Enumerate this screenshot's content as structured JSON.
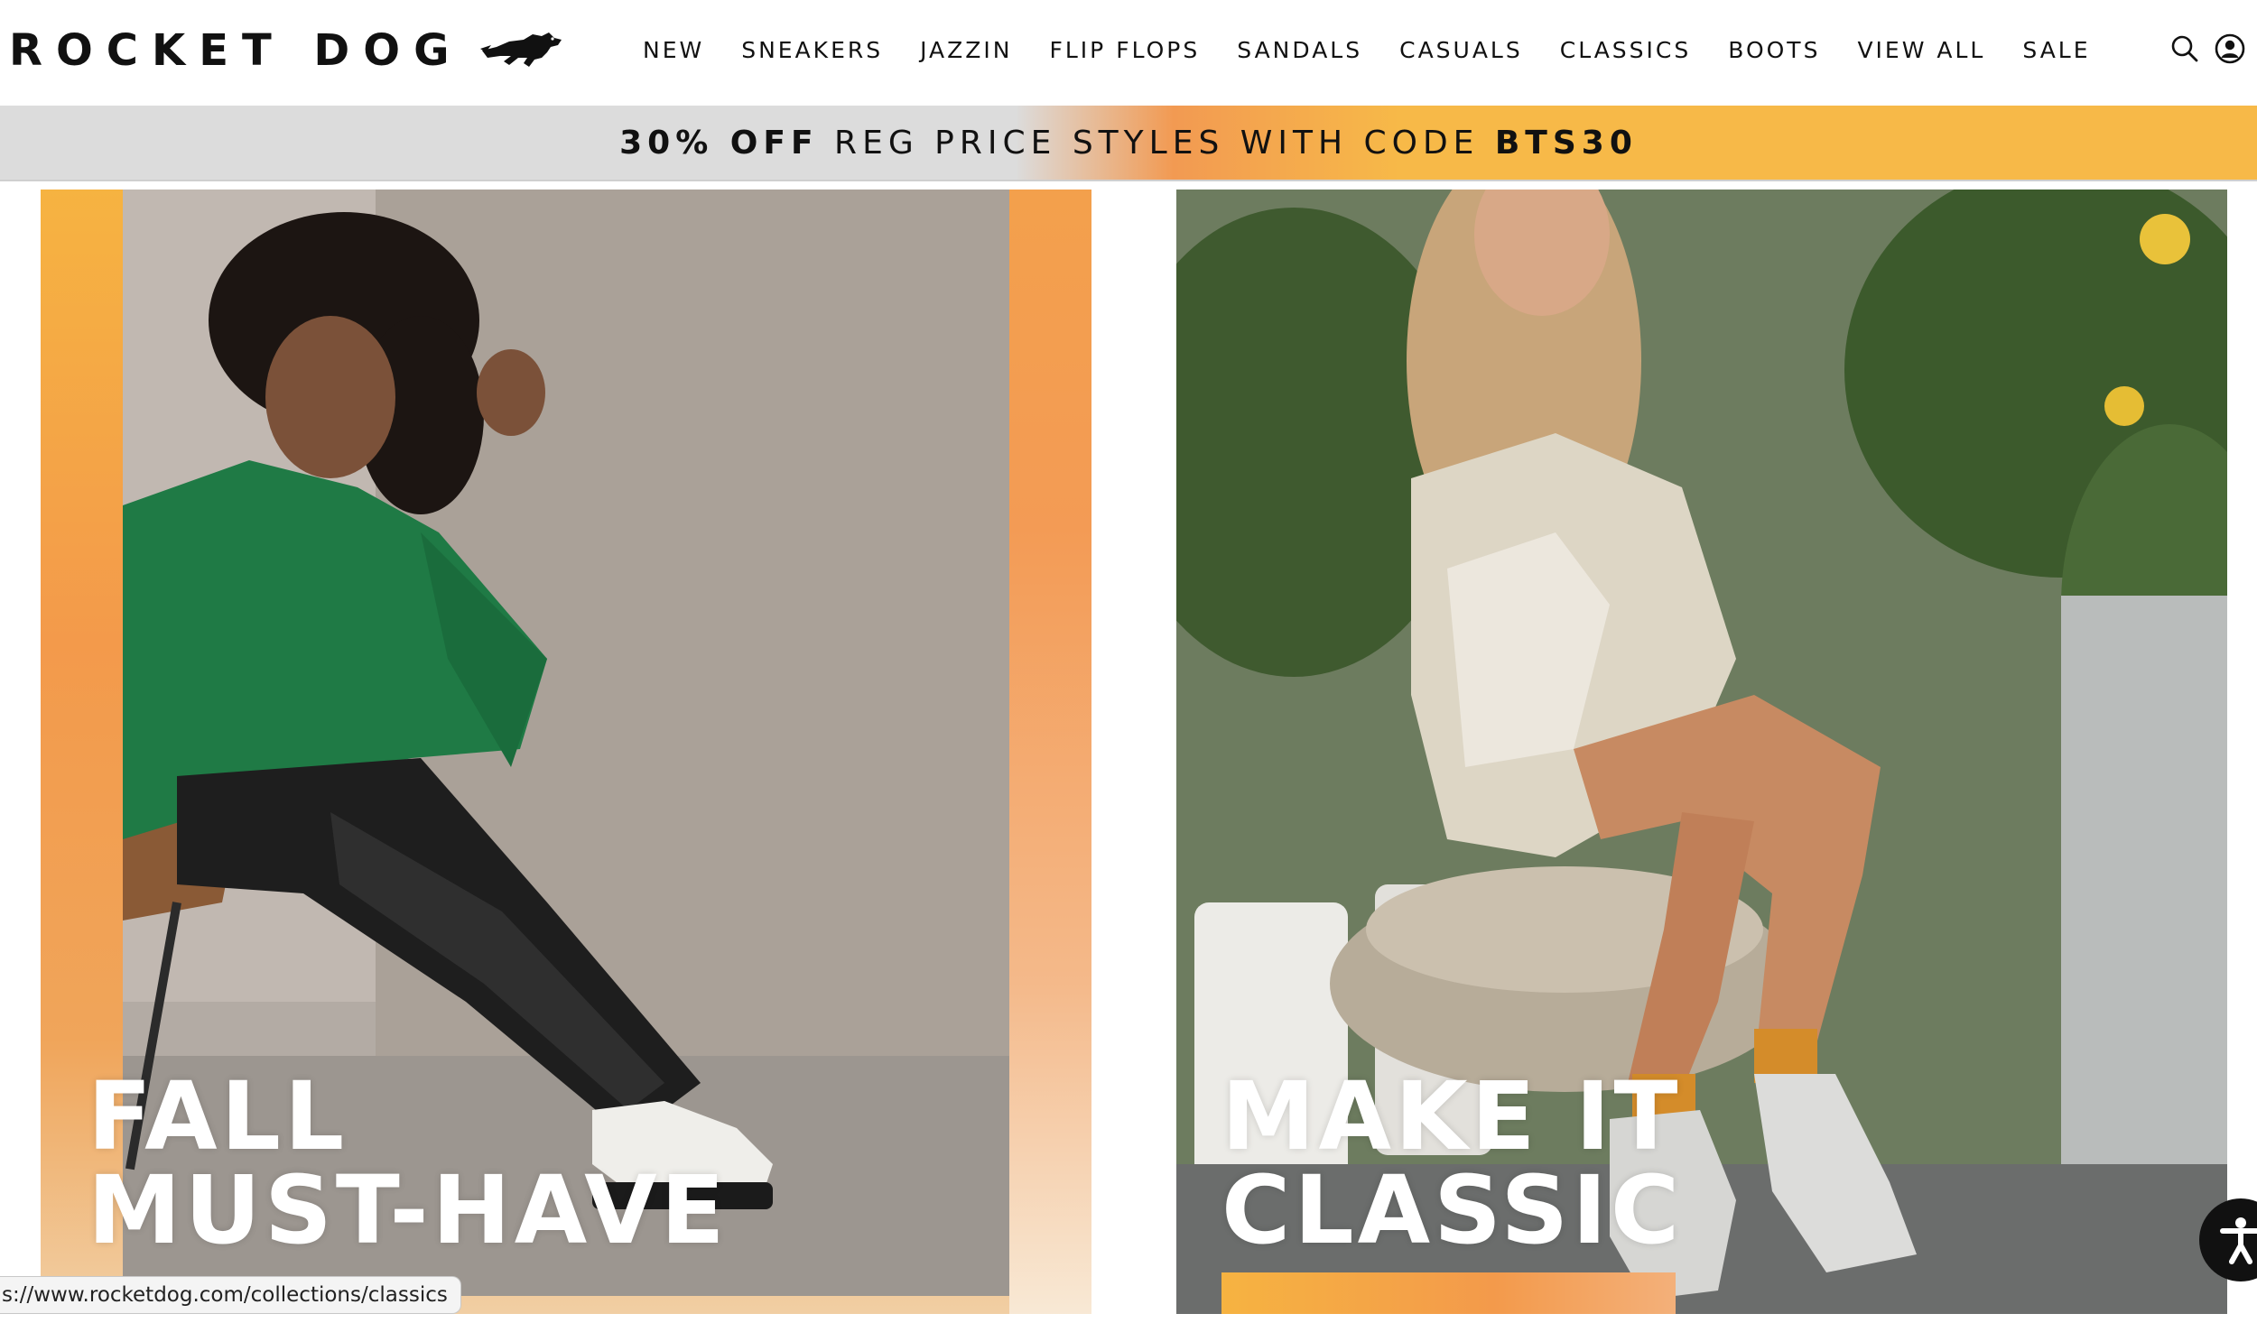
{
  "header": {
    "logo_text": "ROCKET DOG",
    "logo_icon": "running-dog-logo-icon",
    "nav": [
      {
        "label": "NEW"
      },
      {
        "label": "SNEAKERS"
      },
      {
        "label": "JAZZIN"
      },
      {
        "label": "FLIP FLOPS"
      },
      {
        "label": "SANDALS"
      },
      {
        "label": "CASUALS"
      },
      {
        "label": "CLASSICS"
      },
      {
        "label": "BOOTS"
      },
      {
        "label": "VIEW ALL"
      },
      {
        "label": "SALE"
      }
    ],
    "icons": [
      "search-icon",
      "account-icon"
    ]
  },
  "promo": {
    "bold_lead": "30% OFF",
    "middle": " REG PRICE STYLES WITH CODE ",
    "code": "BTS30"
  },
  "hero": {
    "left": {
      "line1": "FALL",
      "line2": "MUST-HAVE",
      "image": "woman-green-sweater-white-loafers-photo"
    },
    "right": {
      "line1": "MAKE IT",
      "line2": "CLASSIC",
      "image": "woman-white-sneakers-sitting-on-log-photo"
    }
  },
  "status_bar": {
    "url": "s://www.rocketdog.com/collections/classics"
  },
  "accessibility": {
    "icon": "accessibility-icon"
  },
  "colors": {
    "accent_orange": "#f39a4b",
    "accent_yellow": "#f7b948",
    "promo_gray": "#dcdcdc",
    "text": "#111111"
  }
}
